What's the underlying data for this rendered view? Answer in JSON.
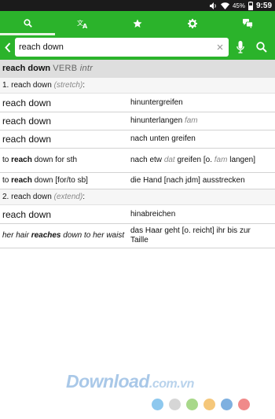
{
  "status_bar": {
    "battery_percent": "45%",
    "time": "9:59"
  },
  "tabs": [
    {
      "icon": "search-icon",
      "active": true
    },
    {
      "icon": "translate-icon",
      "active": false
    },
    {
      "icon": "star-icon",
      "active": false
    },
    {
      "icon": "gear-icon",
      "active": false
    },
    {
      "icon": "chat-bubbles-icon",
      "active": false
    }
  ],
  "search": {
    "value": "reach down",
    "placeholder": ""
  },
  "entry": {
    "headword": "reach down",
    "pos": "VERB",
    "pos_sub": "intr",
    "senses": [
      {
        "label": "1. reach down",
        "gloss": "(stretch)",
        "rows": [
          {
            "src_pre": "",
            "src_bold": "",
            "src_post": "reach down",
            "tgt_pre": "hinuntergreifen",
            "tgt_lab": "",
            "tgt_post": ""
          },
          {
            "src_pre": "",
            "src_bold": "",
            "src_post": "reach down",
            "tgt_pre": "hinunterlangen ",
            "tgt_lab": "fam",
            "tgt_post": ""
          },
          {
            "src_pre": "",
            "src_bold": "",
            "src_post": "reach down",
            "tgt_pre": "nach unten greifen",
            "tgt_lab": "",
            "tgt_post": ""
          },
          {
            "src_pre": "to ",
            "src_bold": "reach",
            "src_post": " down for sth",
            "tgt_pre": "nach etw ",
            "tgt_lab": "dat",
            "tgt_bold": " greifen",
            "tgt_mid": " [o. ",
            "tgt_lab2": "fam",
            "tgt_post": " langen]"
          },
          {
            "src_pre": "to ",
            "src_bold": "reach",
            "src_post": " down [for/to sb]",
            "tgt_pre": "die Hand [nach jdm] ausstrecken",
            "tgt_lab": "",
            "tgt_post": ""
          }
        ]
      },
      {
        "label": "2. reach down",
        "gloss": "(extend)",
        "rows": [
          {
            "src_pre": "",
            "src_bold": "",
            "src_post": "reach down",
            "tgt_pre": "hinabreichen",
            "tgt_lab": "",
            "tgt_post": ""
          },
          {
            "src_pre": "her hair ",
            "src_bold": "reaches",
            "src_post": " down to her waist",
            "tgt_pre": "das Haar geht [o. reicht] ihr bis zur Taille",
            "tgt_lab": "",
            "tgt_post": ""
          }
        ]
      }
    ]
  },
  "watermark": {
    "brand": "Download",
    "tld": ".com.vn",
    "dot_colors": [
      "#8ec8ee",
      "#d6d6d6",
      "#a8d88a",
      "#f5c77a",
      "#7eb0e0",
      "#f08a8a"
    ]
  },
  "colors": {
    "accent": "#2bb32b"
  }
}
